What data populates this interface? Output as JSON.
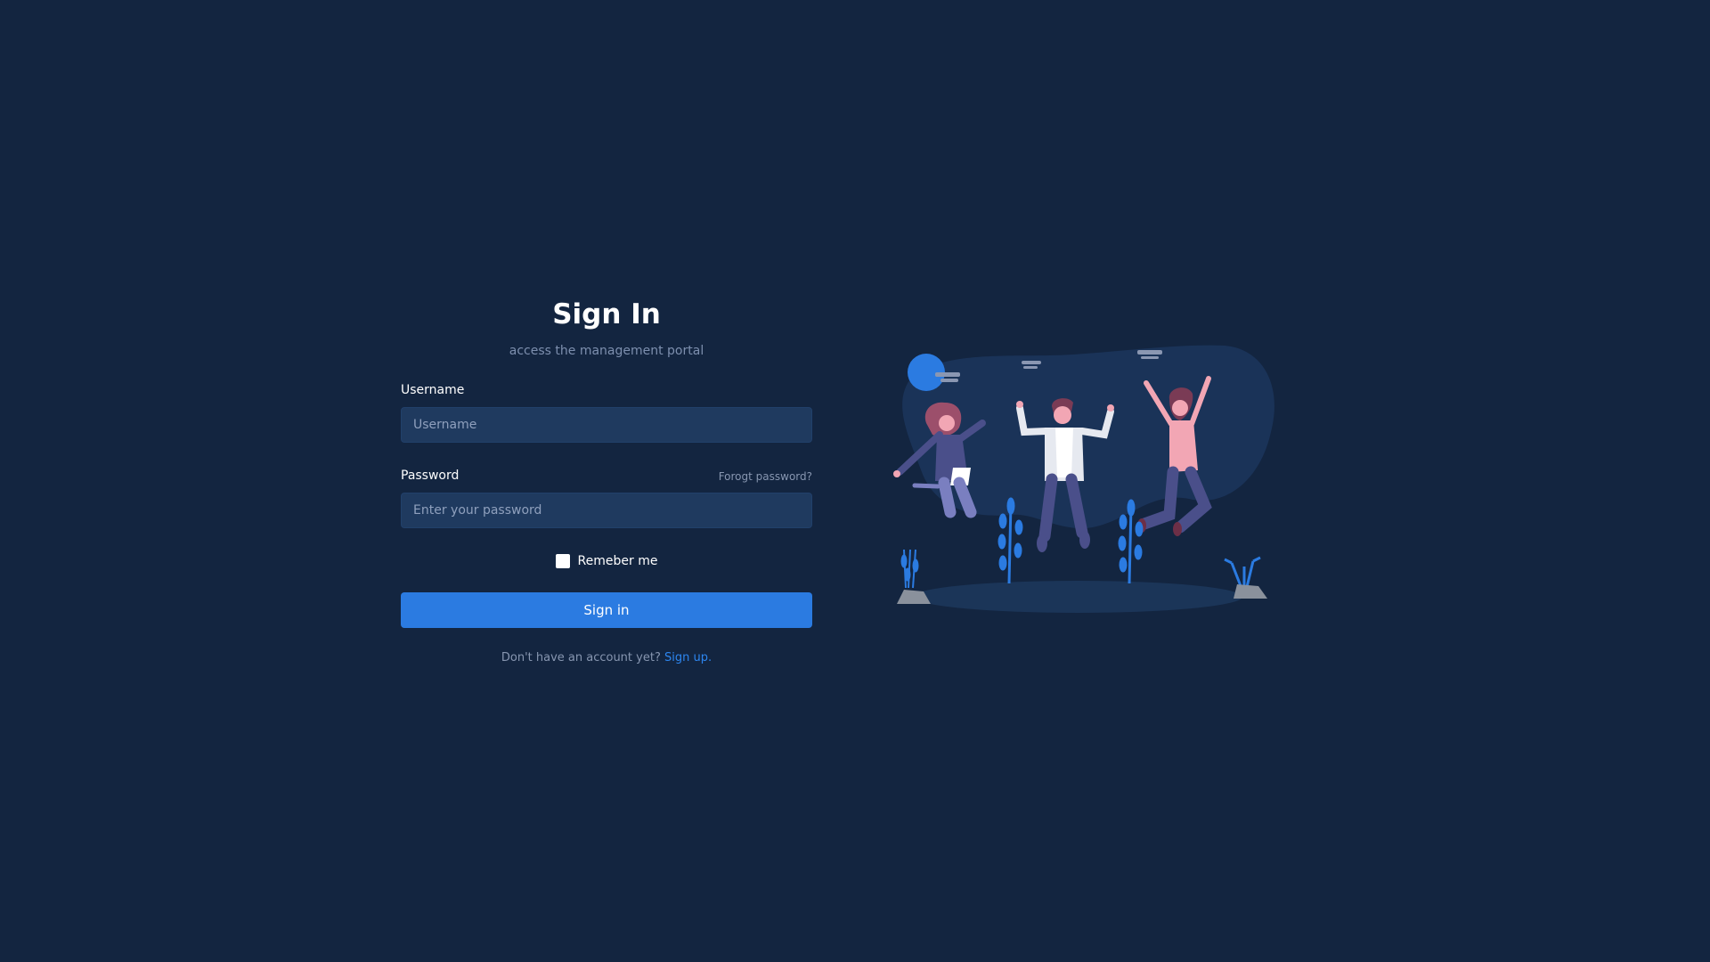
{
  "header": {
    "title": "Sign In",
    "subtitle": "access the management portal"
  },
  "form": {
    "username": {
      "label": "Username",
      "placeholder": "Username",
      "value": ""
    },
    "password": {
      "label": "Password",
      "placeholder": "Enter your password",
      "value": "",
      "forgot_label": "Forogt password?"
    },
    "remember": {
      "label": "Remeber me",
      "checked": false
    },
    "submit_label": "Sign in"
  },
  "footer": {
    "prompt": "Don't have an account yet?",
    "signup_label": "Sign up."
  },
  "illustration": {
    "icon": "people-jumping-illustration"
  },
  "colors": {
    "background": "#132540",
    "accent": "#2b7be1",
    "field_background": "#1f3a5f",
    "muted_text": "#7d8fae"
  }
}
